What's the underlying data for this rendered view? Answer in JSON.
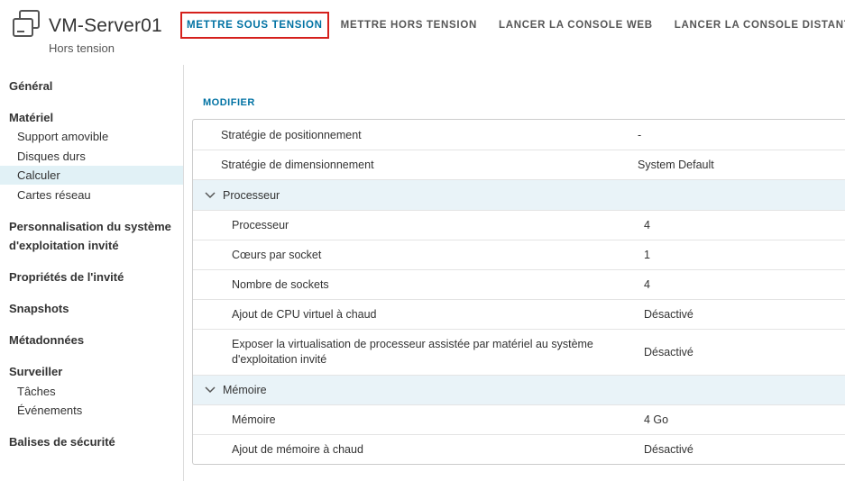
{
  "header": {
    "vm_name": "VM-Server01",
    "power_state": "Hors tension",
    "actions": [
      "METTRE SOUS TENSION",
      "METTRE HORS TENSION",
      "LANCER LA CONSOLE WEB",
      "LANCER LA CONSOLE DISTANTE"
    ]
  },
  "sidebar": {
    "general": "Général",
    "hardware": "Matériel",
    "hardware_items": [
      "Support amovible",
      "Disques durs",
      "Calculer",
      "Cartes réseau"
    ],
    "guest_os_customization_line1": "Personnalisation du système",
    "guest_os_customization_line2": "d'exploitation invité",
    "guest_properties": "Propriétés de l'invité",
    "snapshots": "Snapshots",
    "metadata": "Métadonnées",
    "monitor": "Surveiller",
    "monitor_items": [
      "Tâches",
      "Événements"
    ],
    "security_tags": "Balises de sécurité",
    "selected_item": "Calculer"
  },
  "main": {
    "edit_label": "MODIFIER",
    "rows": [
      {
        "label": "Stratégie de positionnement",
        "value": "-"
      },
      {
        "label": "Stratégie de dimensionnement",
        "value": "System Default"
      }
    ],
    "cpu_group": {
      "title": "Processeur",
      "rows": [
        {
          "label": "Processeur",
          "value": "4"
        },
        {
          "label": "Cœurs par socket",
          "value": "1"
        },
        {
          "label": "Nombre de sockets",
          "value": "4"
        },
        {
          "label": "Ajout de CPU virtuel à chaud",
          "value": "Désactivé"
        },
        {
          "label_line1": "Exposer la virtualisation de processeur assistée par matériel au système",
          "label_line2": "d'exploitation invité",
          "value": "Désactivé"
        }
      ]
    },
    "memory_group": {
      "title": "Mémoire",
      "rows": [
        {
          "label": "Mémoire",
          "value": "4 Go"
        },
        {
          "label": "Ajout de mémoire à chaud",
          "value": "Désactivé"
        }
      ]
    }
  },
  "colors": {
    "accent": "#0072a3",
    "highlight_border": "#d5201c",
    "selected_bg": "#e1f1f6",
    "group_bg": "#e9f3f8"
  },
  "icons": {
    "vm": "virtual-machine-icon",
    "expand": "chevron-down-icon"
  }
}
